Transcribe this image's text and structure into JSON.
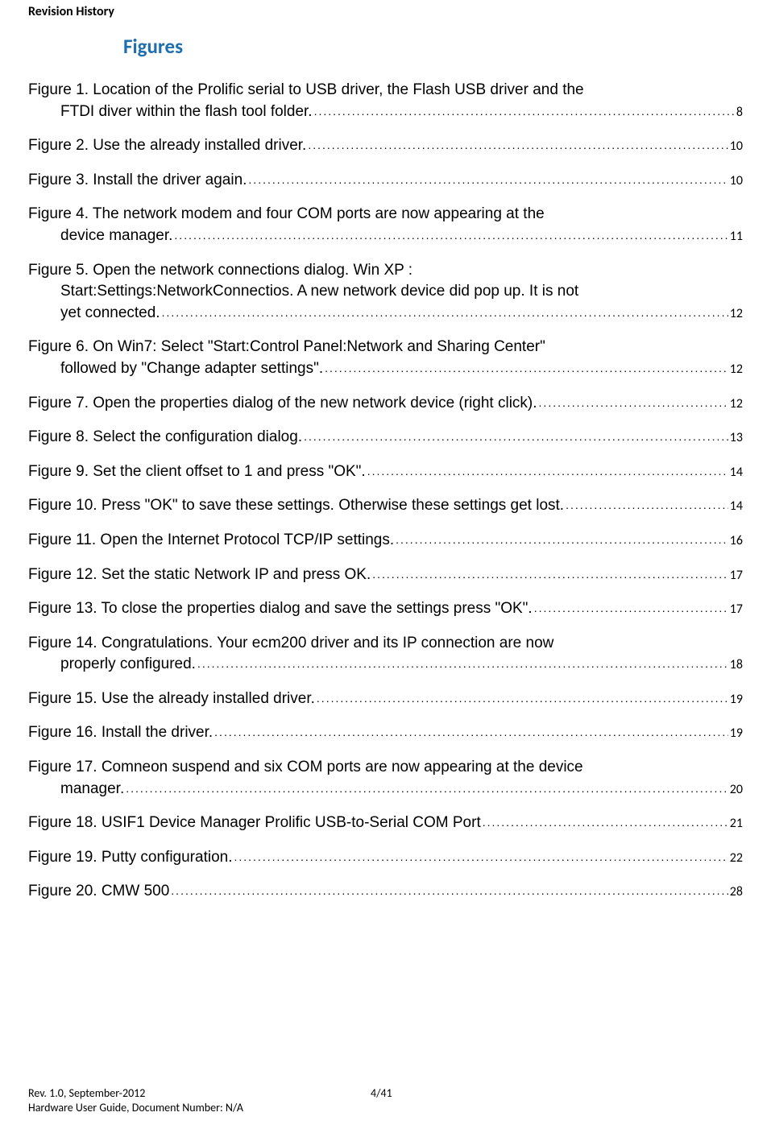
{
  "header": "Revision History",
  "figures_title": "Figures",
  "entries": [
    {
      "lines": [
        "Figure 1. Location of the Prolific serial to USB driver, the Flash USB driver and the",
        "FTDI diver within the flash tool folder."
      ],
      "page": "8"
    },
    {
      "lines": [
        "Figure 2. Use the already installed driver."
      ],
      "page": "10"
    },
    {
      "lines": [
        "Figure 3. Install the driver again."
      ],
      "page": "10"
    },
    {
      "lines": [
        "Figure 4. The network modem and four COM ports are now appearing at the",
        "device manager."
      ],
      "page": "11"
    },
    {
      "lines": [
        "Figure 5. Open the network connections dialog. Win XP :",
        "Start:Settings:NetworkConnectios.  A new network device did pop up. It is not",
        "yet connected."
      ],
      "page": "12"
    },
    {
      "lines": [
        "Figure 6. On Win7: Select \"Start:Control Panel:Network and Sharing Center\"",
        "followed by  \"Change adapter settings\"."
      ],
      "page": "12"
    },
    {
      "lines": [
        "Figure 7. Open the properties dialog of the new network device (right click)."
      ],
      "page": "12"
    },
    {
      "lines": [
        "Figure 8. Select the configuration dialog."
      ],
      "page": "13"
    },
    {
      "lines": [
        "Figure 9. Set the client offset to 1 and press \"OK\"."
      ],
      "page": "14"
    },
    {
      "lines": [
        "Figure 10. Press \"OK\" to save these settings. Otherwise these settings get lost."
      ],
      "page": "14"
    },
    {
      "lines": [
        "Figure 11. Open the Internet Protocol TCP/IP settings."
      ],
      "page": "16"
    },
    {
      "lines": [
        "Figure 12. Set the static Network IP and press OK."
      ],
      "page": "17"
    },
    {
      "lines": [
        "Figure 13. To close the properties dialog and save the settings press \"OK\"."
      ],
      "page": "17"
    },
    {
      "lines": [
        "Figure 14.  Congratulations. Your ecm200 driver and its IP connection are now",
        "properly configured."
      ],
      "page": "18"
    },
    {
      "lines": [
        "Figure 15. Use the already installed driver."
      ],
      "page": "19"
    },
    {
      "lines": [
        "Figure 16. Install the driver."
      ],
      "page": "19"
    },
    {
      "lines": [
        "Figure 17.  Comneon suspend and six COM ports are now appearing at the device",
        "manager."
      ],
      "page": "20"
    },
    {
      "lines": [
        "Figure 18. USIF1 Device Manager Prolific USB-to-Serial COM Port"
      ],
      "page": "21"
    },
    {
      "lines": [
        "Figure 19. Putty configuration."
      ],
      "page": "22"
    },
    {
      "lines": [
        "Figure 20. CMW 500"
      ],
      "page": "28"
    }
  ],
  "footer": {
    "line1": "Rev. 1.0, September-2012",
    "line2": "Hardware User Guide, Document Number: N/A",
    "page": "4/41"
  }
}
